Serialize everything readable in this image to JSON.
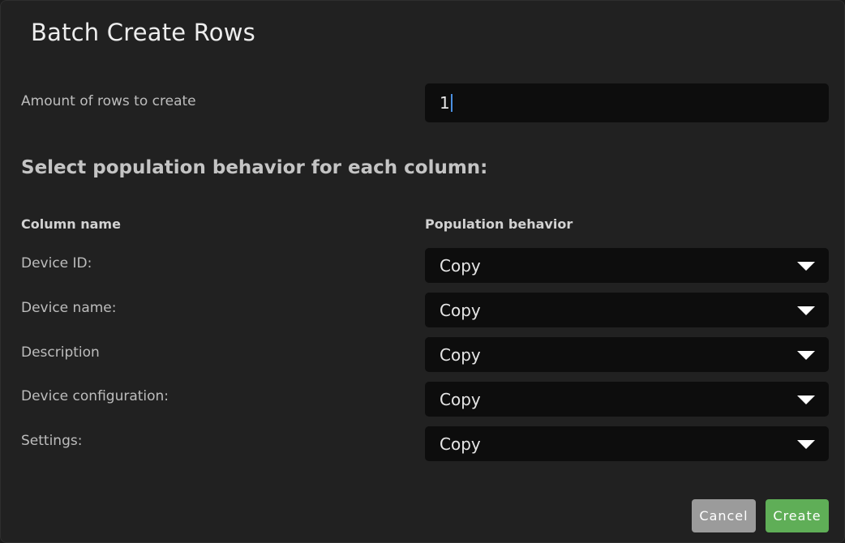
{
  "dialog": {
    "title": "Batch Create Rows",
    "amount": {
      "label": "Amount of rows to create",
      "value": "1"
    },
    "section_heading": "Select population behavior for each column:",
    "table": {
      "column_header": "Column name",
      "behavior_header": "Population behavior",
      "rows": [
        {
          "name": "Device ID:",
          "behavior": "Copy"
        },
        {
          "name": "Device name:",
          "behavior": "Copy"
        },
        {
          "name": "Description",
          "behavior": "Copy"
        },
        {
          "name": "Device configuration:",
          "behavior": "Copy"
        },
        {
          "name": "Settings:",
          "behavior": "Copy"
        }
      ]
    },
    "buttons": {
      "cancel": "Cancel",
      "create": "Create"
    }
  },
  "colors": {
    "background": "#212121",
    "input_background": "#0d0d0d",
    "cancel_button": "#9b9b9b",
    "create_button": "#5fae57",
    "caret": "#4a90e2"
  },
  "icons": {
    "dropdown": "chevron-down-icon"
  }
}
